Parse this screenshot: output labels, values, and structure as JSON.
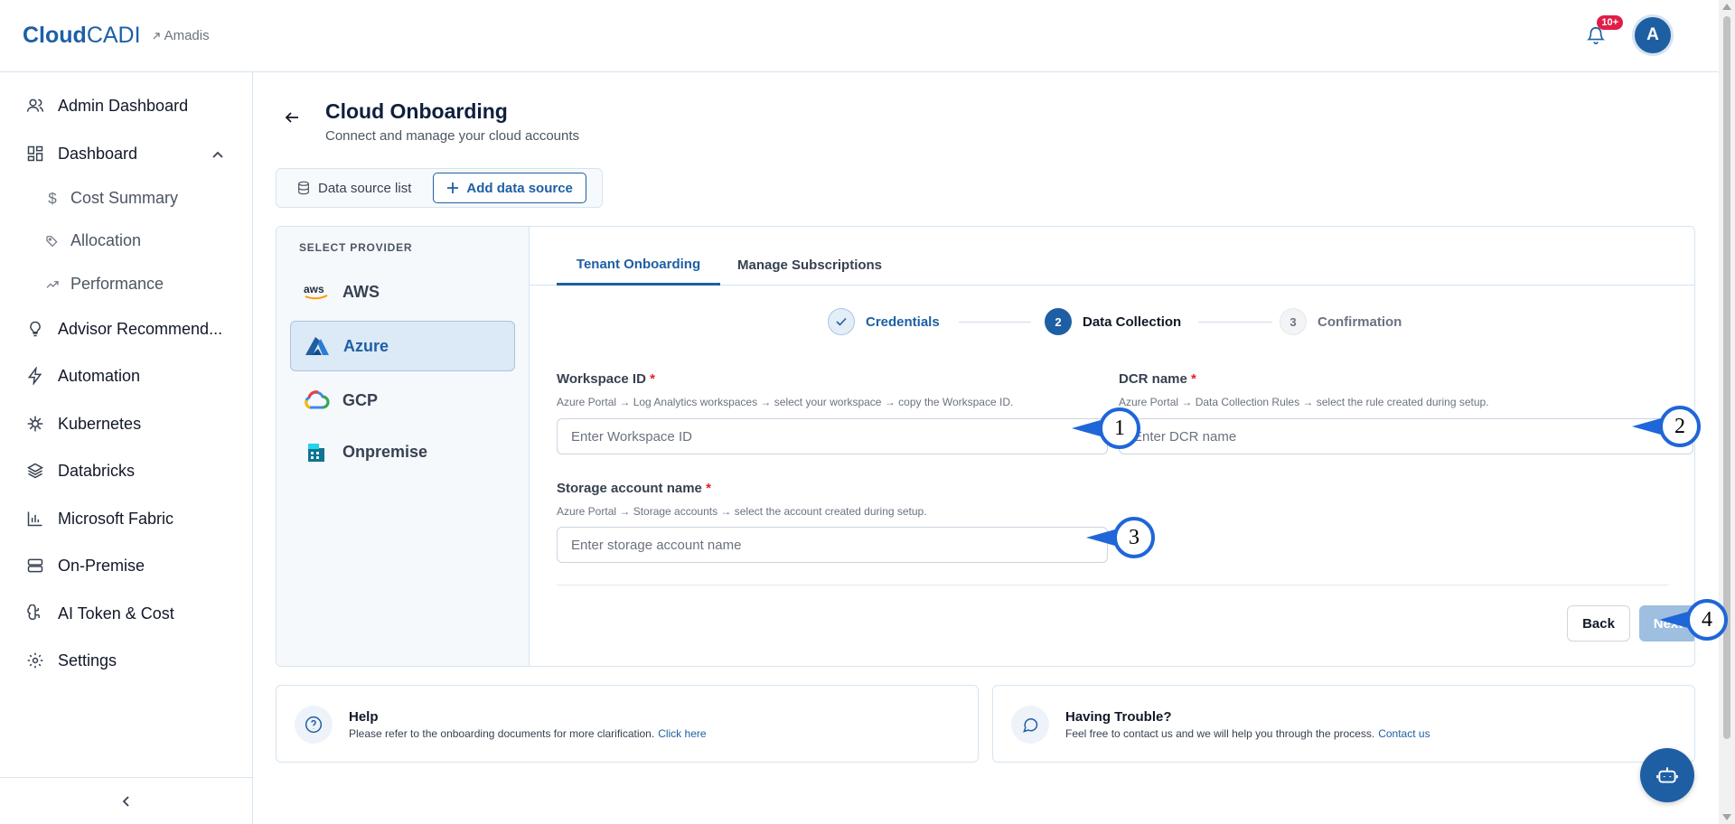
{
  "header": {
    "logo_bold": "Cloud",
    "logo_light": "CADI",
    "tenant": "Amadis",
    "notification_badge": "10+",
    "avatar_initial": "A"
  },
  "sidebar": {
    "items": [
      {
        "label": "Admin Dashboard",
        "icon": "users-icon"
      },
      {
        "label": "Dashboard",
        "icon": "dashboard-grid-icon"
      },
      {
        "label": "Cost Summary",
        "icon": "dollar-icon"
      },
      {
        "label": "Allocation",
        "icon": "tags-icon"
      },
      {
        "label": "Performance",
        "icon": "trend-icon"
      },
      {
        "label": "Advisor Recommend...",
        "icon": "lightbulb-icon"
      },
      {
        "label": "Automation",
        "icon": "bolt-icon"
      },
      {
        "label": "Kubernetes",
        "icon": "helm-icon"
      },
      {
        "label": "Databricks",
        "icon": "layers-icon"
      },
      {
        "label": "Microsoft Fabric",
        "icon": "bar-chart-icon"
      },
      {
        "label": "On-Premise",
        "icon": "server-icon"
      },
      {
        "label": "AI Token & Cost",
        "icon": "ai-brain-icon"
      },
      {
        "label": "Settings",
        "icon": "gear-icon"
      }
    ]
  },
  "page": {
    "title": "Cloud Onboarding",
    "subtitle": "Connect and manage your cloud accounts"
  },
  "ds_tabs": {
    "list_label": "Data source list",
    "add_label": "Add data source"
  },
  "providers": {
    "heading": "SELECT PROVIDER",
    "items": [
      {
        "label": "AWS",
        "active": false
      },
      {
        "label": "Azure",
        "active": true
      },
      {
        "label": "GCP",
        "active": false
      },
      {
        "label": "Onpremise",
        "active": false
      }
    ]
  },
  "tabs": {
    "tenant": "Tenant Onboarding",
    "subscriptions": "Manage Subscriptions"
  },
  "stepper": {
    "step1_label": "Credentials",
    "step2_num": "2",
    "step2_label": "Data Collection",
    "step3_num": "3",
    "step3_label": "Confirmation"
  },
  "form": {
    "workspace": {
      "label": "Workspace ID",
      "required": "*",
      "hint": "Azure Portal → Log Analytics workspaces → select your workspace → copy the Workspace ID.",
      "placeholder": "Enter Workspace ID"
    },
    "dcr": {
      "label": "DCR name",
      "required": "*",
      "hint": "Azure Portal → Data Collection Rules → select the rule created during setup.",
      "placeholder": "Enter DCR name"
    },
    "storage": {
      "label": "Storage account name",
      "required": "*",
      "hint": "Azure Portal → Storage accounts → select the account created during setup.",
      "placeholder": "Enter storage account name"
    },
    "back_label": "Back",
    "next_label": "Next"
  },
  "help": {
    "title": "Help",
    "text": "Please refer to the onboarding documents for more clarification.",
    "link": "Click here"
  },
  "trouble": {
    "title": "Having Trouble?",
    "text": "Feel free to contact us and we will help you through the process.",
    "link": "Contact us"
  },
  "callouts": [
    "1",
    "2",
    "3",
    "4"
  ],
  "colors": {
    "accent": "#1e5fa3",
    "callout": "#1f66d8",
    "badge": "#e11d48"
  }
}
